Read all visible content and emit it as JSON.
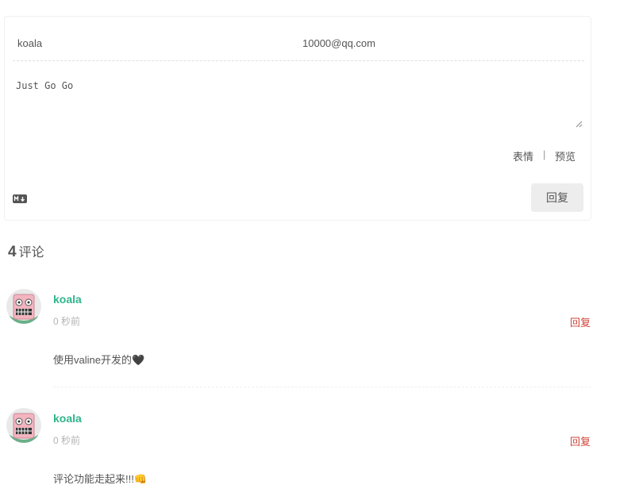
{
  "form": {
    "nick_value": "koala",
    "mail_value": "10000@qq.com",
    "comment_value": "Just Go Go",
    "emoji_label": "表情",
    "separator": "|",
    "preview_label": "预览",
    "markdown_icon": "markdown-icon",
    "submit_label": "回复"
  },
  "comment_count": {
    "number": "4",
    "label": "评论"
  },
  "comments": [
    {
      "nick": "koala",
      "time": "0 秒前",
      "reply_label": "回复",
      "content": "使用valine开发的🖤",
      "avatar_icon": "robot-avatar"
    },
    {
      "nick": "koala",
      "time": "0 秒前",
      "reply_label": "回复",
      "content": "评论功能走起来!!!👊",
      "avatar_icon": "robot-avatar"
    }
  ],
  "colors": {
    "nick": "#2eb58a",
    "reply": "#d0453b",
    "submit_bg": "#ededed",
    "avatar_bg": "#f3b4bf"
  }
}
